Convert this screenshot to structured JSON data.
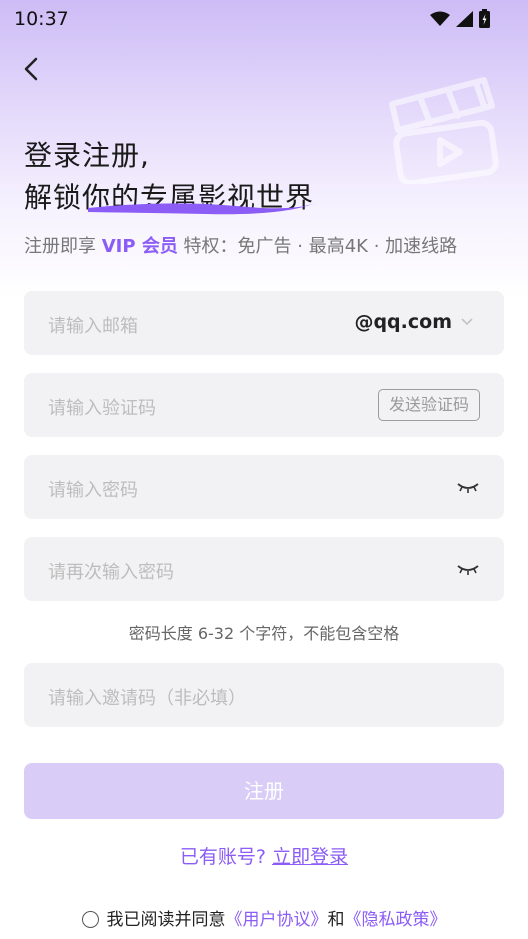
{
  "status_bar": {
    "time": "10:37"
  },
  "header": {
    "title_line1": "登录注册,",
    "title_line2": "解锁你的专属影视世界"
  },
  "subtitle": {
    "prefix": "注册即享 ",
    "vip": "VIP 会员",
    "suffix": " 特权：免广告 · 最高4K · 加速线路"
  },
  "form": {
    "email_placeholder": "请输入邮箱",
    "email_domain": "@qq.com",
    "code_placeholder": "请输入验证码",
    "send_code_label": "发送验证码",
    "password_placeholder": "请输入密码",
    "confirm_password_placeholder": "请再次输入密码",
    "password_hint": "密码长度 6-32 个字符，不能包含空格",
    "invite_placeholder": "请输入邀请码（非必填）",
    "register_label": "注册"
  },
  "login": {
    "prompt": "已有账号?",
    "link": "立即登录"
  },
  "agreement": {
    "text": "我已阅读并同意",
    "user_agreement": "《用户协议》",
    "and": "和",
    "privacy_policy": "《隐私政策》"
  },
  "colors": {
    "accent": "#8B5CF6",
    "button_disabled": "#d9cdf8",
    "field_bg": "#f2f2f4"
  },
  "icons": [
    "back-arrow-icon",
    "film-clapper-icon",
    "chevron-down-icon",
    "eye-closed-icon",
    "wifi-icon",
    "signal-icon",
    "battery-icon"
  ]
}
